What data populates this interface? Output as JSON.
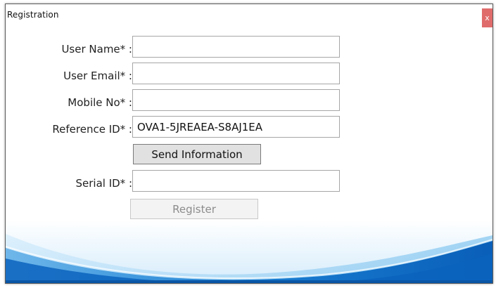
{
  "window": {
    "title": "Registration",
    "close_label": "x"
  },
  "form": {
    "user_name": {
      "label": "User Name* :",
      "value": ""
    },
    "user_email": {
      "label": "User Email* :",
      "value": ""
    },
    "mobile_no": {
      "label": "Mobile No* :",
      "value": ""
    },
    "reference_id": {
      "label": "Reference ID* :",
      "value": "OVA1-5JREAEA-S8AJ1EA"
    },
    "send_label": "Send Information",
    "serial_id": {
      "label": "Serial ID* :",
      "value": ""
    },
    "register_label": "Register"
  },
  "colors": {
    "close_button": "#e06b6b",
    "wave_dark": "#0b6fc8",
    "wave_light": "#cfe9fb"
  }
}
